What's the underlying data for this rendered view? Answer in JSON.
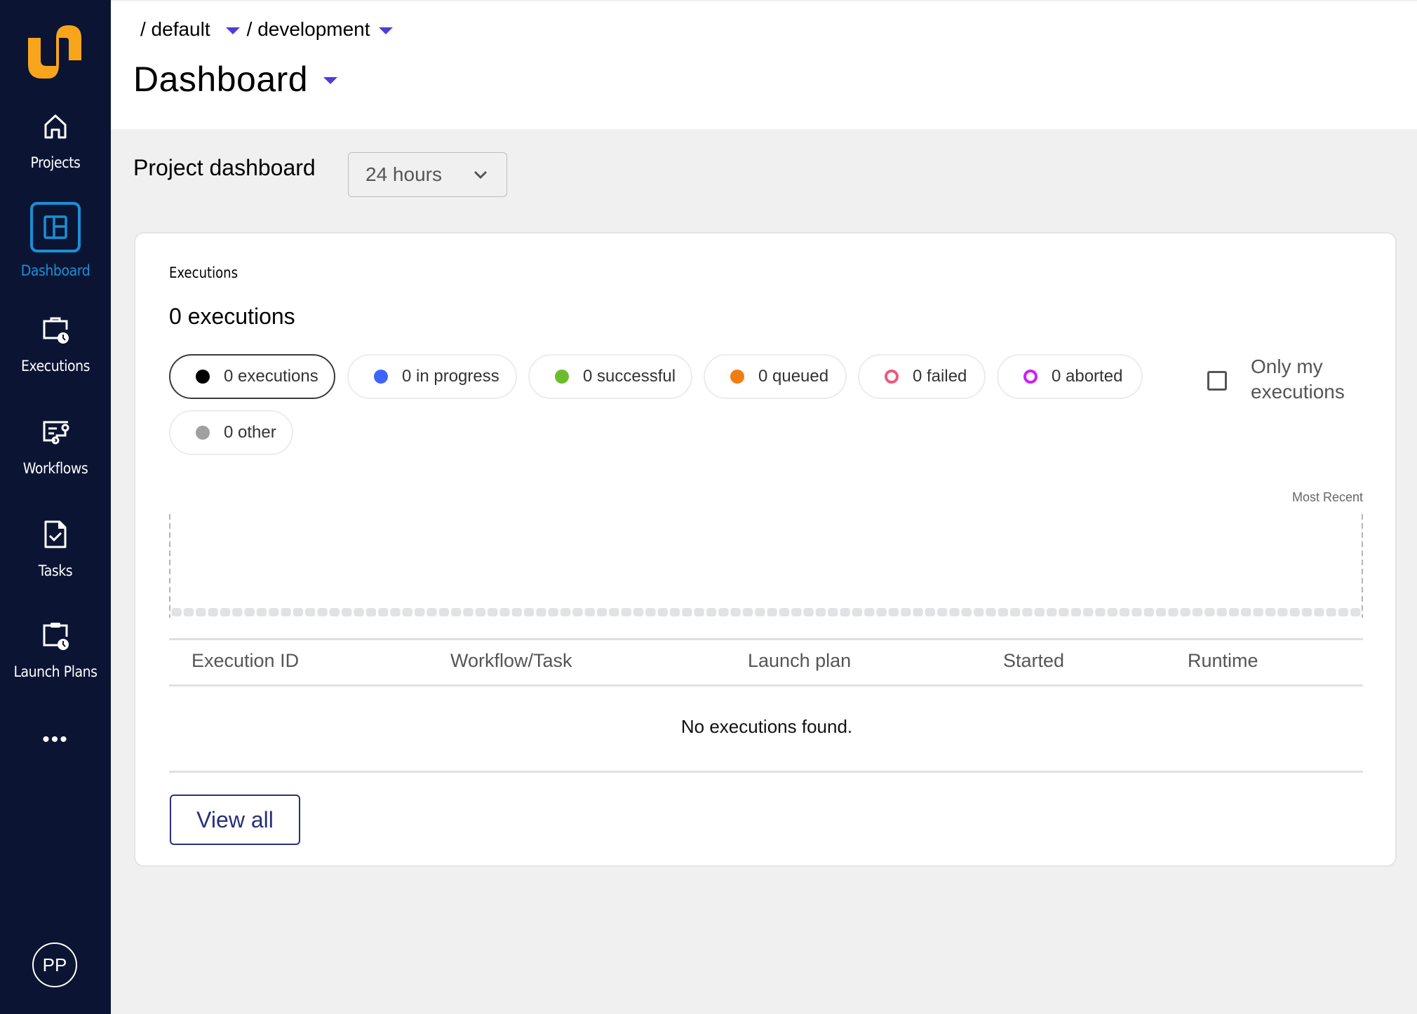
{
  "sidebar": {
    "logo": "flyte-logo",
    "items": [
      {
        "label": "Projects",
        "icon": "home-icon",
        "active": false
      },
      {
        "label": "Dashboard",
        "icon": "dashboard-icon",
        "active": true
      },
      {
        "label": "Executions",
        "icon": "executions-icon",
        "active": false
      },
      {
        "label": "Workflows",
        "icon": "workflows-icon",
        "active": false
      },
      {
        "label": "Tasks",
        "icon": "tasks-icon",
        "active": false
      },
      {
        "label": "Launch Plans",
        "icon": "launch-plans-icon",
        "active": false
      }
    ],
    "more_label": "•••",
    "avatar_initials": "PP"
  },
  "header": {
    "breadcrumb": [
      {
        "label": "/ default"
      },
      {
        "label": "/ development"
      }
    ],
    "title": "Dashboard"
  },
  "project_dashboard": {
    "title": "Project dashboard",
    "time_range": "24 hours"
  },
  "executions_card": {
    "label": "Executions",
    "count_text": "0 executions",
    "chips": [
      {
        "label": "0 executions",
        "color": "#000000",
        "style": "filled",
        "selected": true
      },
      {
        "label": "0 in progress",
        "color": "#3e64ff",
        "style": "filled",
        "selected": false
      },
      {
        "label": "0 successful",
        "color": "#6cbd2d",
        "style": "filled",
        "selected": false
      },
      {
        "label": "0 queued",
        "color": "#f07d14",
        "style": "filled",
        "selected": false
      },
      {
        "label": "0 failed",
        "color": "#ea5c7c",
        "style": "ring",
        "selected": false
      },
      {
        "label": "0 aborted",
        "color": "#cc1ff5",
        "style": "ring",
        "selected": false
      },
      {
        "label": "0 other",
        "color": "#a0a0a0",
        "style": "filled",
        "selected": false
      }
    ],
    "only_mine": {
      "label": "Only my executions",
      "checked": false
    },
    "most_recent_label": "Most Recent",
    "table": {
      "columns": [
        "Execution ID",
        "Workflow/Task",
        "Launch plan",
        "Started",
        "Runtime"
      ],
      "rows": [],
      "empty_text": "No executions found."
    },
    "view_all_label": "View all"
  },
  "chart_data": {
    "type": "bar",
    "title": "",
    "xlabel": "",
    "ylabel": "",
    "annotations": [
      "Most Recent"
    ],
    "bar_count": 98,
    "values": "all zero (empty placeholder bars)",
    "series": [
      {
        "name": "executions",
        "values_all": 0
      }
    ]
  },
  "colors": {
    "sidebar_bg": "#0b1533",
    "accent_blue": "#1a8fd6",
    "caret_purple": "#4c3ddb",
    "logo_orange": "#f9a51c",
    "button_navy": "#27307a",
    "placeholder_bar": "#e1e2e3"
  }
}
